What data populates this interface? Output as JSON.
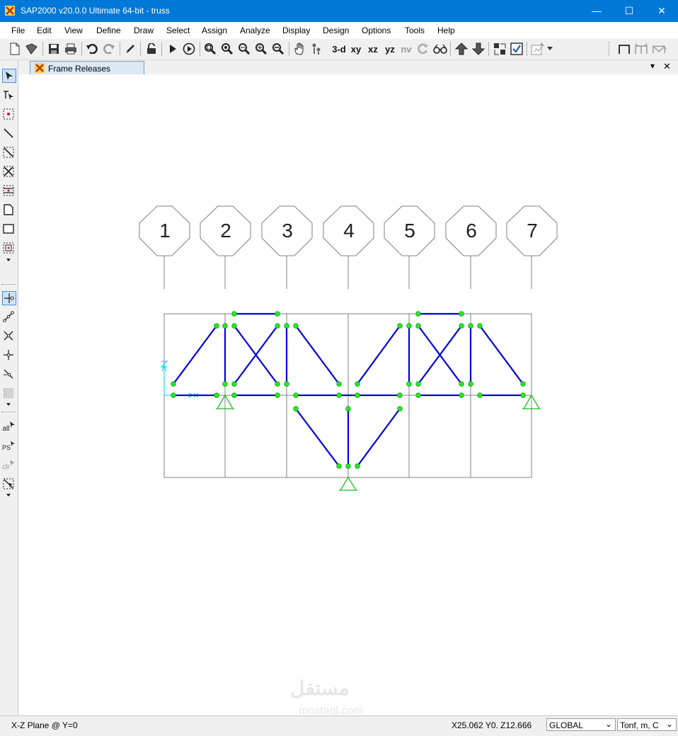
{
  "window": {
    "title": "SAP2000 v20.0.0 Ultimate 64-bit - truss",
    "minimize_glyph": "—",
    "maximize_glyph": "☐",
    "close_glyph": "✕"
  },
  "menu": [
    "File",
    "Edit",
    "View",
    "Define",
    "Draw",
    "Select",
    "Assign",
    "Analyze",
    "Display",
    "Design",
    "Options",
    "Tools",
    "Help"
  ],
  "toolbar": {
    "view_3d": "3-d",
    "view_xy": "xy",
    "view_xz": "xz",
    "view_yz": "yz",
    "view_nv": "nv"
  },
  "left_toolbar": {
    "select_all": "all",
    "select_previous": "PS",
    "clear_selection": "clr"
  },
  "tab": {
    "label": "Frame Releases",
    "dropdown_glyph": "▾",
    "close_glyph": "✕"
  },
  "grid_labels": [
    "1",
    "2",
    "3",
    "4",
    "5",
    "6",
    "7"
  ],
  "status": {
    "plane": "X-Z Plane @ Y=0",
    "coords": "X25.062  Y0.  Z12.666",
    "coord_system": "GLOBAL",
    "units": "Tonf, m, C",
    "combo_arrow": "⌄"
  },
  "watermark": {
    "text": "مستقل",
    "sub": "mostaql.com"
  },
  "colors": {
    "titlebar": "#0078d7",
    "frame": "#0000dd",
    "joint_release": "#22ee22",
    "support": "#22bb22",
    "grid": "#808080",
    "axis": "#00c8ff"
  }
}
